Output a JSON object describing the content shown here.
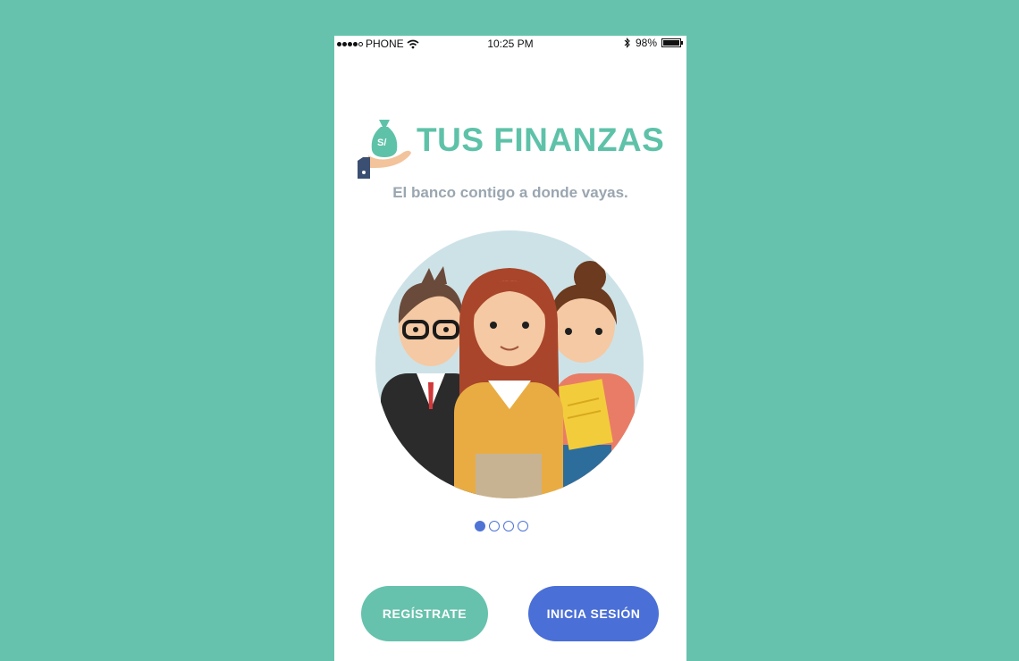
{
  "statusbar": {
    "carrier": "PHONE",
    "time": "10:25 PM",
    "battery_text": "98%",
    "battery_level": 0.98
  },
  "header": {
    "brand": "TUS FINANZAS",
    "tagline": "El banco contigo a donde vayas.",
    "logo_symbol": "S/"
  },
  "pager": {
    "count": 4,
    "active_index": 0
  },
  "actions": {
    "register_label": "REGÍSTRATE",
    "login_label": "INICIA SESIÓN"
  },
  "colors": {
    "background": "#66c2ac",
    "brand": "#5ec2a9",
    "primary": "#4a6fd6",
    "secondary": "#66c2ac"
  }
}
